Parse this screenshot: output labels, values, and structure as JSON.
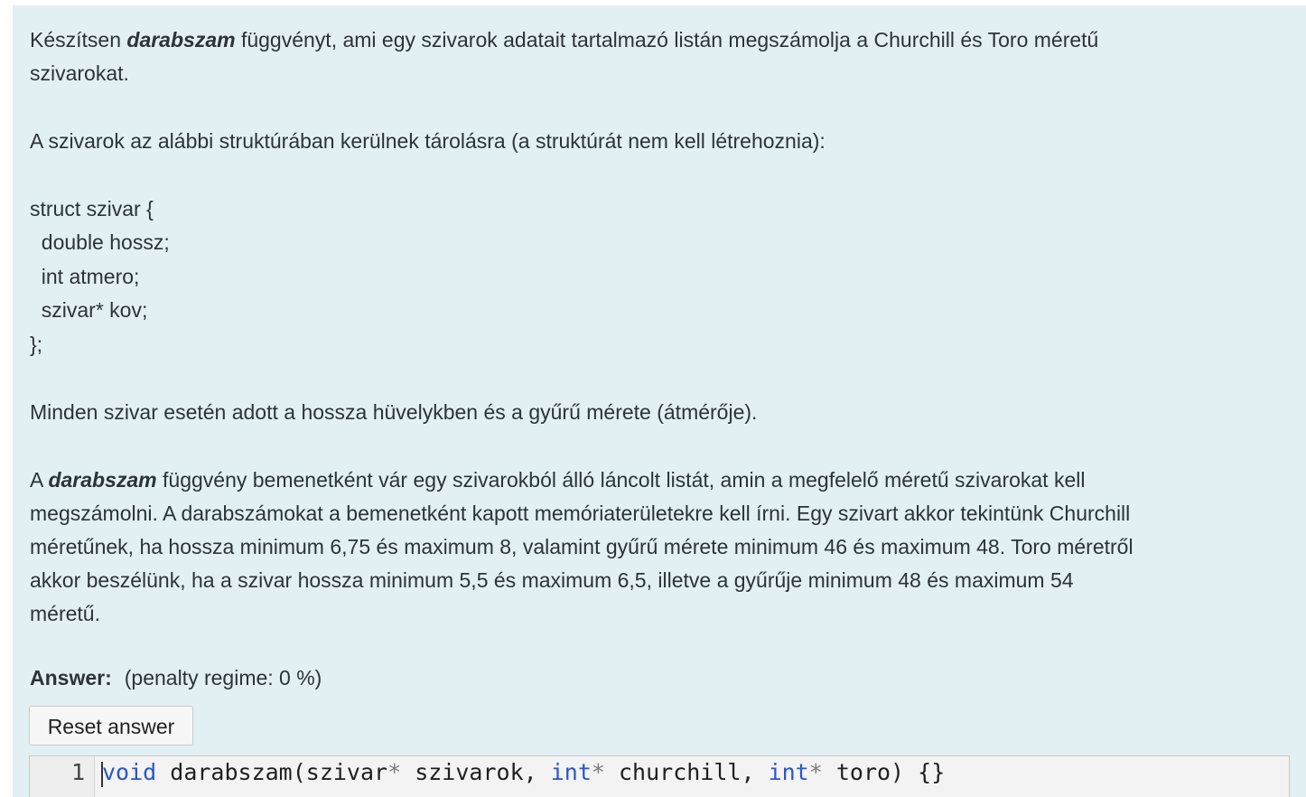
{
  "question": {
    "p1_pre": "Készítsen ",
    "p1_fn": "darabszam",
    "p1_post": " függvényt, ami egy szivarok adatait tartalmazó listán megszámolja a Churchill és Toro méretű",
    "p1_line2": "szivarokat.",
    "p2": "A szivarok az alábbi struktúrában kerülnek tárolásra (a struktúrát nem kell létrehoznia):",
    "struct_lines": [
      "struct szivar {",
      "  double hossz;",
      "  int atmero;",
      "  szivar* kov;",
      "};"
    ],
    "p3": "Minden szivar esetén adott a hossza hüvelykben és a gyűrű mérete (átmérője).",
    "p4_pre": "A ",
    "p4_fn": "darabszam",
    "p4_post": " függvény bemenetként vár egy szivarokból álló láncolt listát, amin a megfelelő méretű szivarokat kell",
    "p4_line2": "megszámolni. A darabszámokat a bemenetként kapott memóriaterületekre kell írni. Egy szivart akkor tekintünk Churchill",
    "p4_line3": "méretűnek, ha hossza minimum 6,75 és maximum 8, valamint gyűrű mérete minimum 46 és maximum 48. Toro méretről",
    "p4_line4": "akkor beszélünk, ha a szivar hossza minimum 5,5 és maximum 6,5, illetve a gyűrűje minimum 48 és maximum 54",
    "p4_line5": "méretű."
  },
  "answer": {
    "label": "Answer:",
    "penalty": "(penalty regime: 0 %)",
    "reset_label": "Reset answer"
  },
  "editor": {
    "line_number": "1",
    "tokens": {
      "kw_void": "void",
      "t1": " darabszam(szivar",
      "star1": "*",
      "t2": " szivarok, ",
      "kw_int1": "int",
      "star2": "*",
      "t3": " churchill, ",
      "kw_int2": "int",
      "star3": "*",
      "t4": " toro) {}"
    }
  },
  "colors": {
    "panel_bg": "#e3f0f3",
    "keyword": "#2a56c9",
    "text": "#2b3438"
  }
}
